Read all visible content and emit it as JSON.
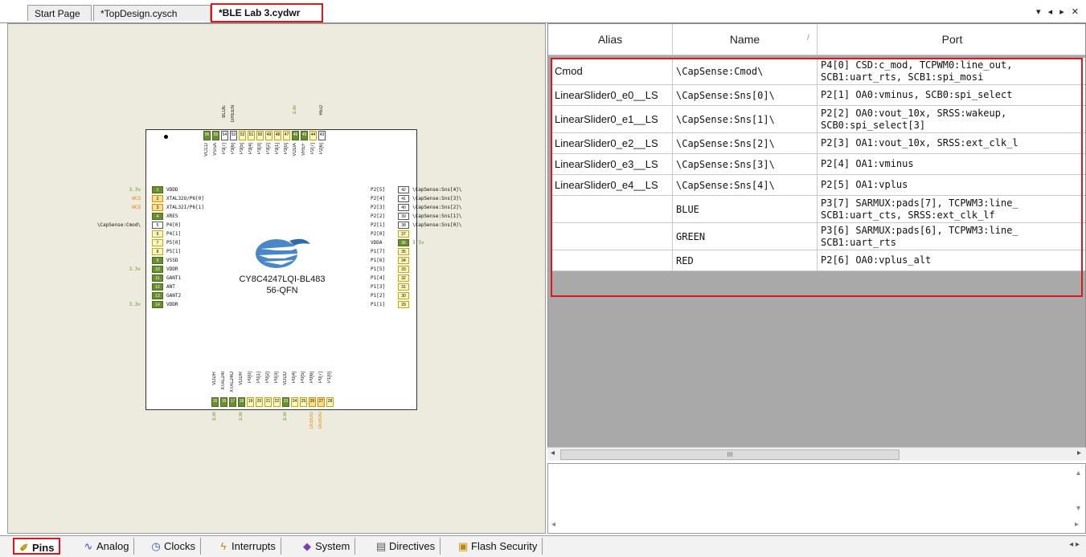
{
  "doc_tabs": [
    {
      "label": "Start Page"
    },
    {
      "label": "*TopDesign.cysch"
    },
    {
      "label": "*BLE Lab 3.cydwr"
    }
  ],
  "tab_controls": "▾ ◂ ▸ ✕",
  "chip": {
    "part": "CY8C4247LQI-BL483",
    "package": "56-QFN",
    "left_pins": [
      {
        "num": "1",
        "name": "VDDD",
        "note": "3.3v",
        "kind": "g"
      },
      {
        "num": "2",
        "name": "XTAL32O/P6[0]",
        "note": "WCO",
        "kind": "o"
      },
      {
        "num": "3",
        "name": "XTAL32I/P6[1]",
        "note": "WCO",
        "kind": "o"
      },
      {
        "num": "4",
        "name": "XRES",
        "note": "",
        "kind": "g"
      },
      {
        "num": "5",
        "name": "P4[0]",
        "note": "\\CapSense:Cmod\\",
        "kind": "w"
      },
      {
        "num": "6",
        "name": "P4[1]",
        "note": "",
        "kind": "y"
      },
      {
        "num": "7",
        "name": "P5[0]",
        "note": "",
        "kind": "y"
      },
      {
        "num": "8",
        "name": "P5[1]",
        "note": "",
        "kind": "y"
      },
      {
        "num": "9",
        "name": "VSSD",
        "note": "",
        "kind": "g"
      },
      {
        "num": "10",
        "name": "VDDR",
        "note": "3.3v",
        "kind": "g"
      },
      {
        "num": "11",
        "name": "GANT1",
        "note": "",
        "kind": "g"
      },
      {
        "num": "12",
        "name": "ANT",
        "note": "",
        "kind": "g"
      },
      {
        "num": "13",
        "name": "GANT2",
        "note": "",
        "kind": "g"
      },
      {
        "num": "14",
        "name": "VDDR",
        "note": "3.3v",
        "kind": "g"
      }
    ],
    "right_pins": [
      {
        "num": "42",
        "name": "P2[5]",
        "note": "\\CapSense:Sns[4]\\",
        "kind": "w"
      },
      {
        "num": "41",
        "name": "P2[4]",
        "note": "\\CapSense:Sns[3]\\",
        "kind": "w"
      },
      {
        "num": "40",
        "name": "P2[3]",
        "note": "\\CapSense:Sns[2]\\",
        "kind": "w"
      },
      {
        "num": "39",
        "name": "P2[2]",
        "note": "\\CapSense:Sns[1]\\",
        "kind": "w"
      },
      {
        "num": "38",
        "name": "P2[1]",
        "note": "\\CapSense:Sns[0]\\",
        "kind": "w"
      },
      {
        "num": "37",
        "name": "P2[0]",
        "note": "",
        "kind": "y"
      },
      {
        "num": "36",
        "name": "VDDA",
        "note": "3.3v",
        "kind": "g"
      },
      {
        "num": "35",
        "name": "P1[7]",
        "note": "",
        "kind": "y"
      },
      {
        "num": "34",
        "name": "P1[6]",
        "note": "",
        "kind": "y"
      },
      {
        "num": "33",
        "name": "P1[5]",
        "note": "",
        "kind": "y"
      },
      {
        "num": "32",
        "name": "P1[4]",
        "note": "",
        "kind": "y"
      },
      {
        "num": "31",
        "name": "P1[3]",
        "note": "",
        "kind": "y"
      },
      {
        "num": "30",
        "name": "P1[2]",
        "note": "",
        "kind": "y"
      },
      {
        "num": "29",
        "name": "P1[1]",
        "note": "",
        "kind": "y"
      }
    ],
    "top_pins": [
      {
        "num": "56",
        "name": "VCCD",
        "kind": "g"
      },
      {
        "num": "55",
        "name": "VSSA",
        "kind": "g"
      },
      {
        "num": "54",
        "name": "P3[7]",
        "kind": "w",
        "note": "BLUE"
      },
      {
        "num": "53",
        "name": "P3[6]",
        "kind": "w",
        "note": "GREEN"
      },
      {
        "num": "52",
        "name": "P3[5]",
        "kind": "y"
      },
      {
        "num": "51",
        "name": "P3[4]",
        "kind": "y"
      },
      {
        "num": "50",
        "name": "P3[3]",
        "kind": "y"
      },
      {
        "num": "49",
        "name": "P3[2]",
        "kind": "y"
      },
      {
        "num": "48",
        "name": "P3[1]",
        "kind": "y"
      },
      {
        "num": "47",
        "name": "P3[0]",
        "kind": "y"
      },
      {
        "num": "46",
        "name": "VDDA",
        "kind": "g",
        "note": "3.3v"
      },
      {
        "num": "45",
        "name": "VREF",
        "kind": "g"
      },
      {
        "num": "44",
        "name": "P2[7]",
        "kind": "y"
      },
      {
        "num": "43",
        "name": "P2[6]",
        "kind": "w",
        "note": "RED"
      }
    ],
    "bottom_pins": [
      {
        "num": "15",
        "name": "VDDR",
        "kind": "g",
        "note": "3.3v"
      },
      {
        "num": "16",
        "name": "XTAL24I",
        "kind": "g"
      },
      {
        "num": "17",
        "name": "XTAL24O",
        "kind": "g"
      },
      {
        "num": "18",
        "name": "VDDR",
        "kind": "g",
        "note": "3.3v"
      },
      {
        "num": "19",
        "name": "P0[0]",
        "kind": "y"
      },
      {
        "num": "20",
        "name": "P0[1]",
        "kind": "y"
      },
      {
        "num": "21",
        "name": "P0[2]",
        "kind": "y"
      },
      {
        "num": "22",
        "name": "P0[3]",
        "kind": "y"
      },
      {
        "num": "23",
        "name": "VDDD",
        "kind": "g",
        "note": "3.3v"
      },
      {
        "num": "24",
        "name": "P0[4]",
        "kind": "y"
      },
      {
        "num": "25",
        "name": "P0[5]",
        "kind": "y"
      },
      {
        "num": "26",
        "name": "P0[6]",
        "kind": "o",
        "note": "DEBUG"
      },
      {
        "num": "27",
        "name": "P0[7]",
        "kind": "o",
        "note": "DEBUG"
      },
      {
        "num": "28",
        "name": "P1[0]",
        "kind": "y"
      }
    ]
  },
  "table": {
    "headers": [
      "Alias",
      "Name",
      "Port"
    ],
    "rows": [
      {
        "alias": "Cmod",
        "name": "\\CapSense:Cmod\\",
        "port": "P4[0] CSD:c_mod, TCPWM0:line_out, SCB1:uart_rts, SCB1:spi_mosi"
      },
      {
        "alias": "LinearSlider0_e0__LS",
        "name": "\\CapSense:Sns[0]\\",
        "port": "P2[1] OA0:vminus, SCB0:spi_select"
      },
      {
        "alias": "LinearSlider0_e1__LS",
        "name": "\\CapSense:Sns[1]\\",
        "port": "P2[2] OA0:vout_10x, SRSS:wakeup, SCB0:spi_select[3]"
      },
      {
        "alias": "LinearSlider0_e2__LS",
        "name": "\\CapSense:Sns[2]\\",
        "port": "P2[3] OA1:vout_10x, SRSS:ext_clk_l"
      },
      {
        "alias": "LinearSlider0_e3__LS",
        "name": "\\CapSense:Sns[3]\\",
        "port": "P2[4] OA1:vminus"
      },
      {
        "alias": "LinearSlider0_e4__LS",
        "name": "\\CapSense:Sns[4]\\",
        "port": "P2[5] OA1:vplus"
      },
      {
        "alias": "",
        "name": "BLUE",
        "port": "P3[7] SARMUX:pads[7], TCPWM3:line_ SCB1:uart_cts, SRSS:ext_clk_lf"
      },
      {
        "alias": "",
        "name": "GREEN",
        "port": "P3[6] SARMUX:pads[6], TCPWM3:line_ SCB1:uart_rts"
      },
      {
        "alias": "",
        "name": "RED",
        "port": "P2[6] OA0:vplus_alt"
      }
    ]
  },
  "hscroll_thumb": "III",
  "bottom_tabs": [
    {
      "label": "Pins",
      "icon": "pins-icon"
    },
    {
      "label": "Analog",
      "icon": "analog-icon"
    },
    {
      "label": "Clocks",
      "icon": "clock-icon"
    },
    {
      "label": "Interrupts",
      "icon": "interrupt-icon"
    },
    {
      "label": "System",
      "icon": "system-icon"
    },
    {
      "label": "Directives",
      "icon": "directives-icon"
    },
    {
      "label": "Flash Security",
      "icon": "lock-icon"
    }
  ],
  "bottom_nav": "◂ ▸"
}
